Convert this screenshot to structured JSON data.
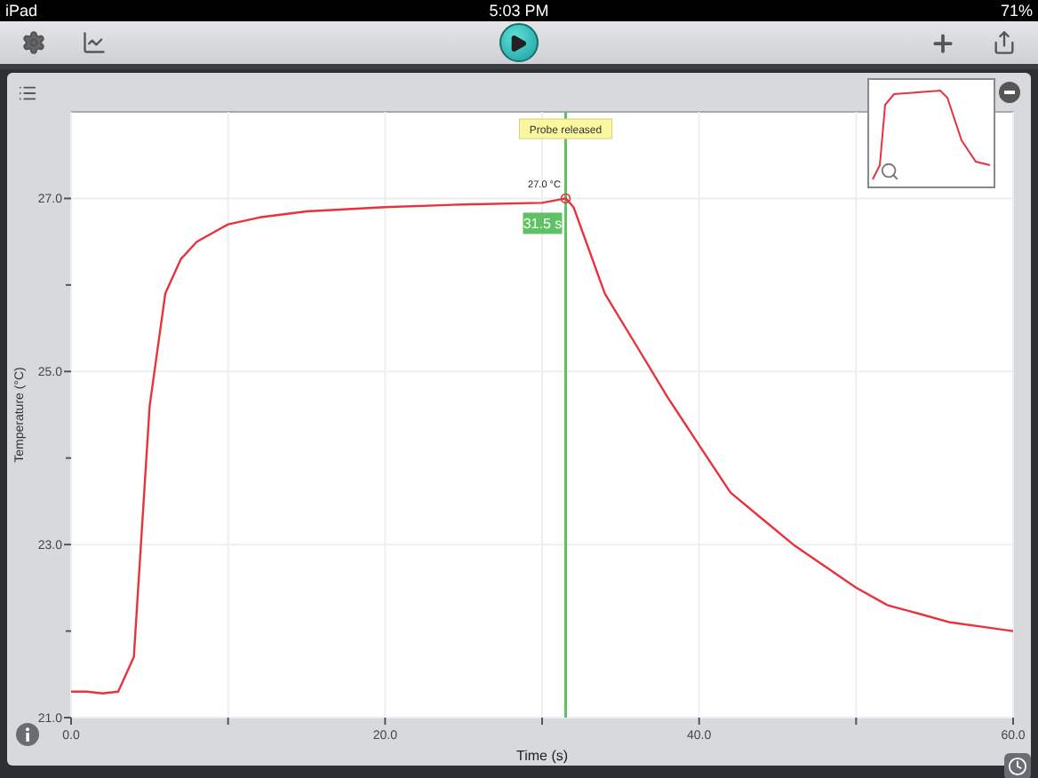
{
  "status_bar": {
    "device": "iPad",
    "time": "5:03 PM",
    "battery": "71%"
  },
  "graph": {
    "chart_data": {
      "type": "line",
      "xlabel": "Time (s)",
      "ylabel": "Temperature (°C)",
      "xlim": [
        0,
        60
      ],
      "ylim": [
        21,
        28
      ],
      "xticks": [
        {
          "value": 0,
          "label": "0.0"
        },
        {
          "value": 20,
          "label": "20.0"
        },
        {
          "value": 40,
          "label": "40.0"
        },
        {
          "value": 60,
          "label": "60.0"
        }
      ],
      "yticks": [
        {
          "value": 21,
          "label": "21.0"
        },
        {
          "value": 23,
          "label": "23.0"
        },
        {
          "value": 25,
          "label": "25.0"
        },
        {
          "value": 27,
          "label": "27.0"
        }
      ],
      "x": [
        0,
        1,
        2,
        3,
        4,
        5,
        6,
        7,
        8,
        10,
        12,
        15,
        20,
        25,
        30,
        31.5,
        32,
        34,
        36,
        38,
        40,
        42,
        44,
        46,
        48,
        50,
        52,
        54,
        56,
        58,
        60
      ],
      "grid": true,
      "ref_lines": [
        {
          "axis": "x",
          "value": 31.5,
          "color": "#5ec265",
          "label": "Probe released"
        }
      ],
      "series": [
        {
          "color": "#e8323c",
          "values": [
            21.3,
            21.3,
            21.28,
            21.3,
            21.7,
            24.6,
            25.9,
            26.3,
            26.5,
            26.7,
            26.78,
            26.85,
            26.9,
            26.93,
            26.95,
            27.0,
            26.9,
            25.9,
            25.3,
            24.7,
            24.15,
            23.6,
            23.3,
            23.0,
            22.75,
            22.5,
            22.3,
            22.2,
            22.1,
            22.05,
            22.0
          ]
        }
      ],
      "annotations": [
        {
          "text": "27.0 °C",
          "x": 31.5,
          "y": 27.0
        },
        "31.5 s"
      ]
    }
  }
}
